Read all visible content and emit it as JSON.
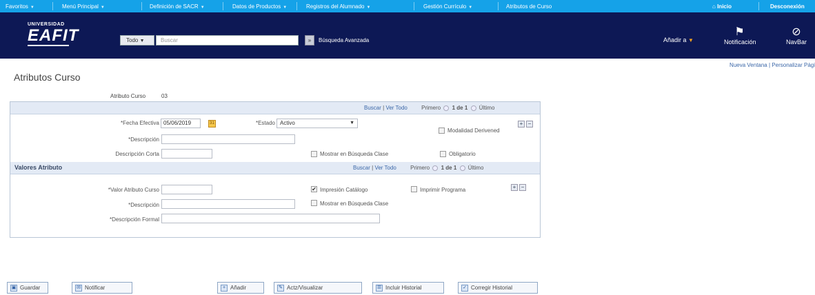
{
  "topnav": {
    "items": [
      "Favoritos",
      "Menú Principal",
      "Definición de SACR",
      "Datos de Productos",
      "Registros del Alumnado",
      "Gestión Currículo",
      "Atributos de Curso"
    ],
    "home": "Inicio",
    "logout": "Desconexión"
  },
  "header": {
    "logo_line1": "UNIVERSIDAD",
    "logo_line2": "EAFIT",
    "scope": "Todo",
    "search_placeholder": "Buscar",
    "advanced_search": "Búsqueda Avanzada",
    "add_menu": "Añadir a",
    "notification": "Notificación",
    "navbar": "NavBar",
    "new_window": "Nueva Ventana",
    "personalize": "Personalizar Pági"
  },
  "page": {
    "title": "Atributos Curso",
    "attribute_label": "Atributo Curso",
    "attribute_value": "03"
  },
  "effdated": {
    "nav_search": "Buscar",
    "nav_viewall": "Ver Todo",
    "nav_first": "Primero",
    "nav_count": "1 de 1",
    "nav_last": "Último",
    "effdate_label": "*Fecha Efectiva",
    "effdate_value": "05/06/2019",
    "status_label": "*Estado",
    "status_value": "Activo",
    "descr_label": "*Descripción",
    "descr_value": "",
    "short_label": "Descripción Corta",
    "short_value": "",
    "show_search_label": "Mostrar en Búsqueda Clase",
    "required_label": "Obligatorio",
    "modality_label": "Modalidad Derivened"
  },
  "values": {
    "title": "Valores Atributo",
    "nav_search": "Buscar",
    "nav_viewall": "Ver Todo",
    "nav_first": "Primero",
    "nav_count": "1 de 1",
    "nav_last": "Último",
    "value_label": "*Valor Atributo Curso",
    "value_value": "",
    "descr_label": "*Descripción",
    "descr_value": "",
    "formal_label": "*Descripción Formal",
    "formal_value": "",
    "catalog_label": "Impresión Catálogo",
    "catalog_checked": true,
    "program_label": "Imprimir Programa",
    "show_search_label": "Mostrar en Búsqueda Clase"
  },
  "toolbar": {
    "save": "Guardar",
    "notify": "Notificar",
    "add": "Añadir",
    "update": "Actz/Visualizar",
    "history": "Incluir Historial",
    "correct": "Corregir Historial"
  }
}
